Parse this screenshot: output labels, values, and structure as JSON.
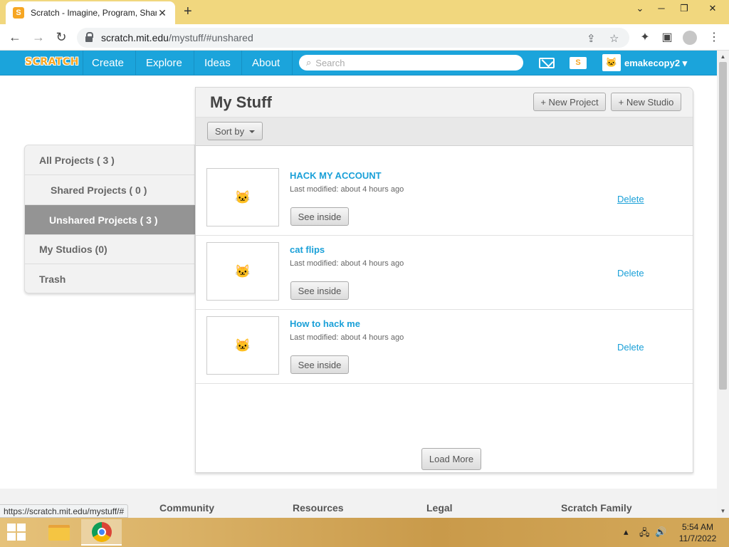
{
  "browser": {
    "tab_title": "Scratch - Imagine, Program, Shar",
    "tab_favicon": "S",
    "url_host": "scratch.mit.edu",
    "url_path": "/mystuff/#unshared",
    "status_url": "https://scratch.mit.edu/mystuff/#"
  },
  "header": {
    "logo": "SCRATCH",
    "nav": [
      "Create",
      "Explore",
      "Ideas",
      "About"
    ],
    "search_placeholder": "Search",
    "username": "emakecopy2",
    "brand_color": "#1ba4db"
  },
  "sidebar": {
    "items": [
      {
        "label": "All Projects ( 3 )"
      },
      {
        "label": "Shared Projects ( 0 )"
      },
      {
        "label": "Unshared Projects ( 3 )"
      },
      {
        "label": "My Studios (0)"
      },
      {
        "label": "Trash"
      }
    ]
  },
  "main": {
    "title": "My Stuff",
    "new_project": "+ New Project",
    "new_studio": "+ New Studio",
    "sort_label": "Sort by",
    "see_inside": "See inside",
    "delete": "Delete",
    "load_more": "Load More",
    "projects": [
      {
        "title": "HACK MY ACCOUNT",
        "modified": "Last modified: about 4 hours ago"
      },
      {
        "title": "cat flips",
        "modified": "Last modified: about 4 hours ago"
      },
      {
        "title": "How to hack me",
        "modified": "Last modified: about 4 hours ago"
      }
    ]
  },
  "footer": {
    "headings": [
      "Community",
      "Resources",
      "Legal",
      "Scratch Family"
    ]
  },
  "taskbar": {
    "time": "5:54 AM",
    "date": "11/7/2022"
  }
}
